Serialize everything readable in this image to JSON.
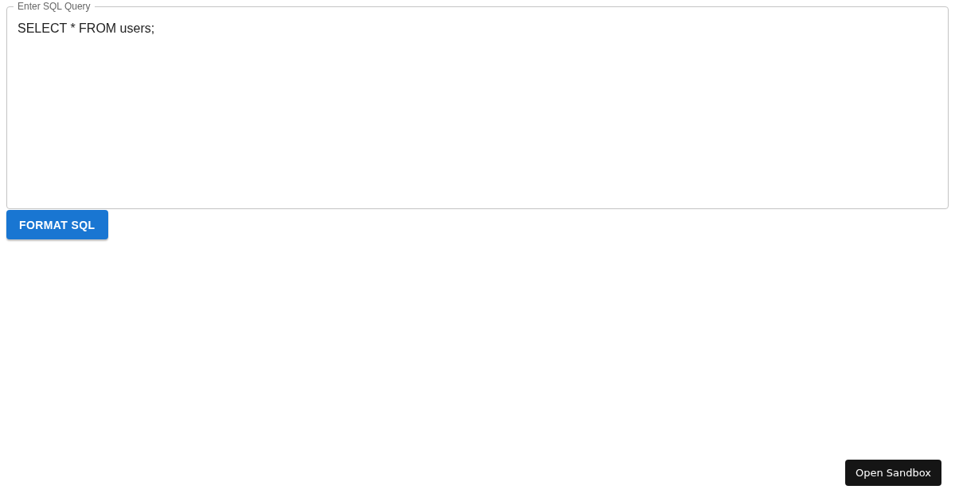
{
  "query_field": {
    "label": "Enter SQL Query",
    "value": "SELECT * FROM users;"
  },
  "format_button": {
    "label": "FORMAT SQL"
  },
  "sandbox_button": {
    "label": "Open Sandbox"
  }
}
